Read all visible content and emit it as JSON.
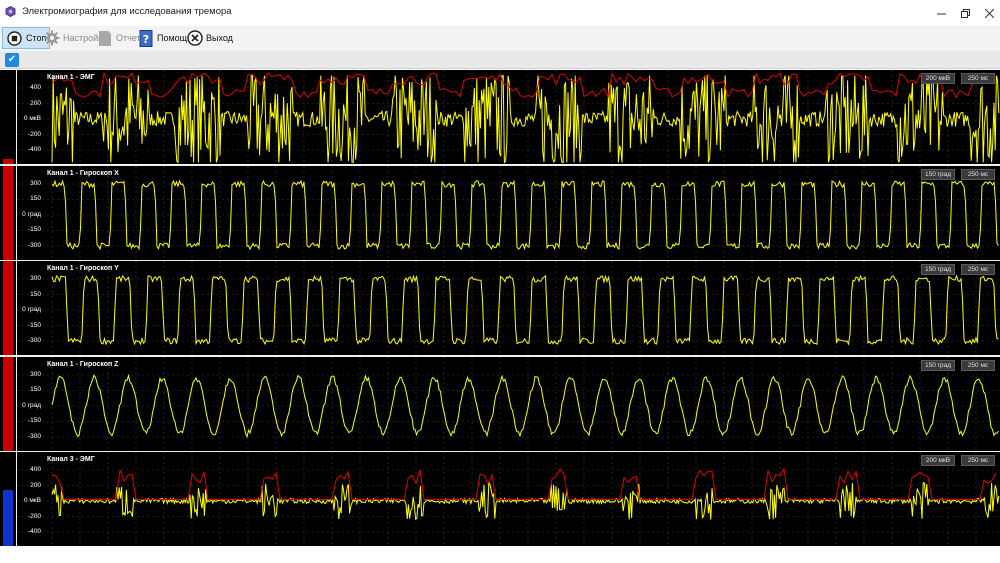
{
  "window": {
    "title": "Электромиография для исследования тремора",
    "icon": "hexagon-app-icon",
    "controls": [
      "minimize-icon",
      "maximize-icon",
      "close-icon"
    ]
  },
  "toolbar": {
    "stop_label": "Стоп",
    "settings_label": "Настройки",
    "report_label": "Отчет",
    "help_label": "Помощь",
    "exit_label": "Выход"
  },
  "colors": {
    "signal": "#ffff00",
    "envelope": "#e00000",
    "meter_red": "#cc0000",
    "meter_blue": "#1033cc",
    "background": "#000000",
    "grid": "#3a3a3a"
  },
  "channels": [
    {
      "title": "Канал 1 - ЭМГ",
      "amp_scale": "200 мкВ",
      "time_scale": "250 мс",
      "y_ticks": [
        "400",
        "200",
        "0 мкВ",
        "-200",
        "-400"
      ],
      "kind": "emg",
      "meter": {
        "color": "#cc0000",
        "level": 0.05
      }
    },
    {
      "title": "Канал 1 - Гироскоп X",
      "amp_scale": "150 град",
      "time_scale": "250 мс",
      "y_ticks": [
        "300",
        "150",
        "0 град",
        "-150",
        "-300"
      ],
      "kind": "gyro",
      "meter": {
        "color": "#cc0000",
        "level": 1.0
      }
    },
    {
      "title": "Канал 1 - Гироскоп Y",
      "amp_scale": "150 град",
      "time_scale": "250 мс",
      "y_ticks": [
        "300",
        "150",
        "0 град",
        "-150",
        "-300"
      ],
      "kind": "gyro",
      "meter": {
        "color": "#cc0000",
        "level": 1.0
      }
    },
    {
      "title": "Канал 1 - Гироскоп Z",
      "amp_scale": "150 град",
      "time_scale": "250 мс",
      "y_ticks": [
        "300",
        "150",
        "0 град",
        "-150",
        "-300"
      ],
      "kind": "gyro",
      "meter": {
        "color": "#cc0000",
        "level": 1.0
      }
    },
    {
      "title": "Канал 3 - ЭМГ",
      "amp_scale": "200 мкВ",
      "time_scale": "250 мс",
      "y_ticks": [
        "400",
        "200",
        "0 мкВ",
        "-200",
        "-400"
      ],
      "kind": "emg-low",
      "meter": {
        "color": "#1033cc",
        "level": 0.6
      }
    }
  ]
}
